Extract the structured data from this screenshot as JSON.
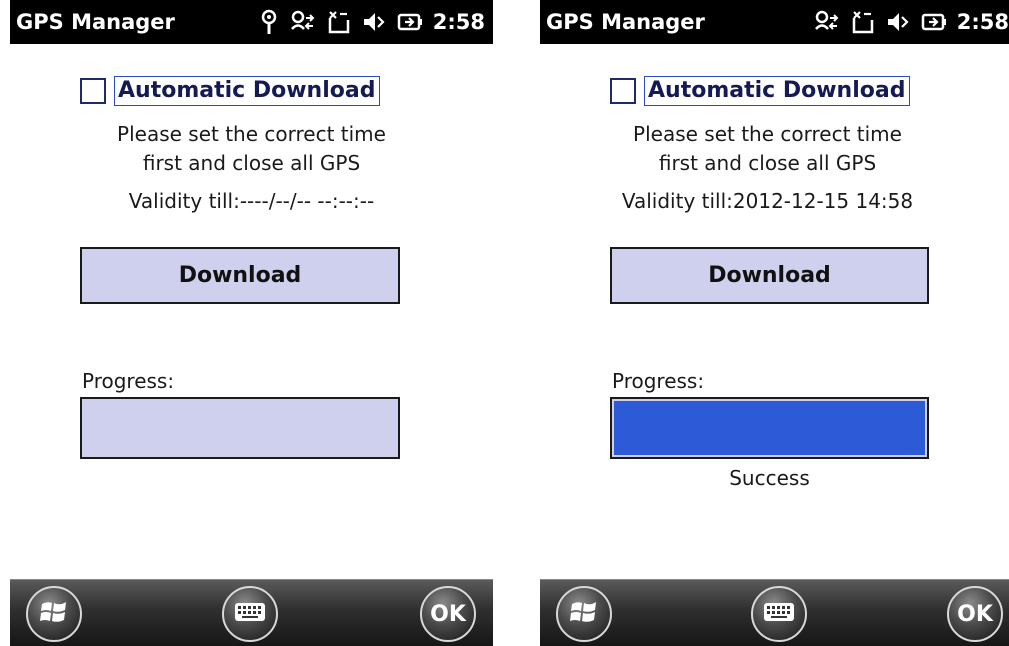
{
  "screens": [
    {
      "app_title": "GPS Manager",
      "status_icons": [
        "antenna-icon",
        "sync-icon",
        "message-icon",
        "speaker-icon",
        "battery-icon"
      ],
      "clock": "2:58",
      "auto_download_label": "Automatic Download",
      "auto_download_checked": false,
      "message_line1": "Please set the correct time",
      "message_line2": "first and close all GPS",
      "validity": "Validity till:----/--/-- --:--:--",
      "download_label": "Download",
      "progress_label": "Progress:",
      "progress": 0,
      "status": "",
      "ok_label": "OK"
    },
    {
      "app_title": "GPS Manager",
      "status_icons": [
        "sync-icon",
        "message-icon",
        "speaker-icon",
        "battery-icon"
      ],
      "clock": "2:58",
      "auto_download_label": "Automatic Download",
      "auto_download_checked": false,
      "message_line1": "Please set the correct time",
      "message_line2": "first and close all GPS",
      "validity": "Validity till:2012-12-15 14:58",
      "download_label": "Download",
      "progress_label": "Progress:",
      "progress": 1.0,
      "status": "Success",
      "ok_label": "OK"
    }
  ],
  "colors": {
    "button_fill": "#cfcfee",
    "progress_fill": "#2d5bd7",
    "title_bar": "#000000",
    "label_border": "#2c49c8"
  }
}
